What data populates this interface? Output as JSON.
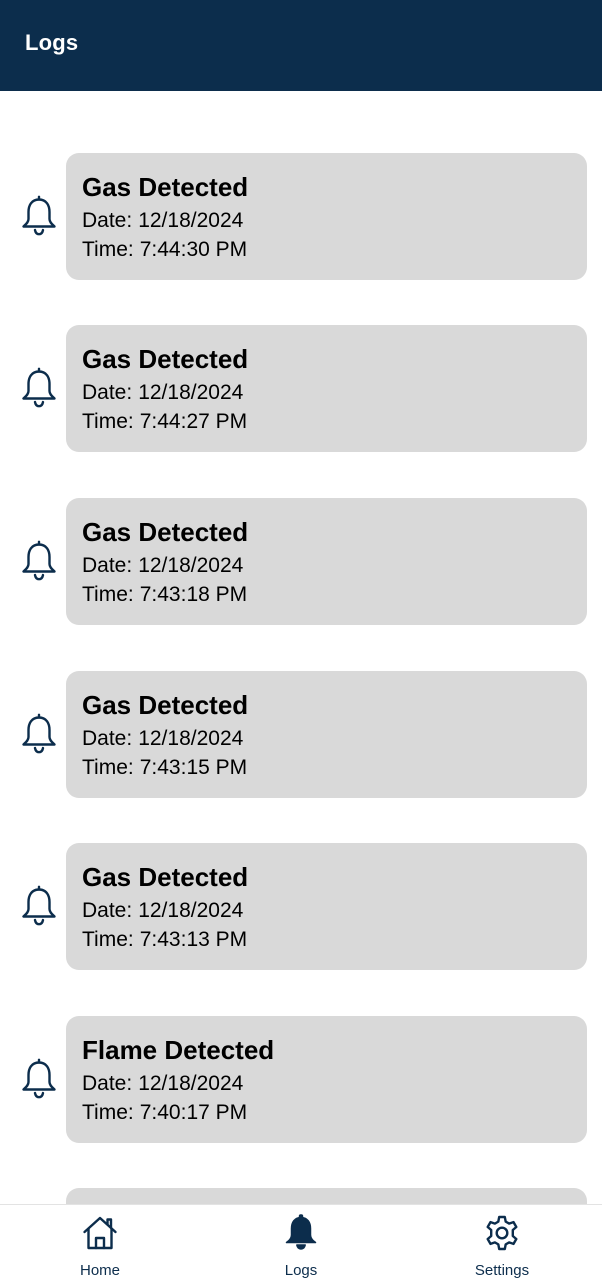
{
  "app_bar": {
    "title": "Logs"
  },
  "logs": [
    {
      "title": "Gas Detected",
      "date_label": "Date:",
      "date": "12/18/2024",
      "time_label": "Time:",
      "time": "7:44:30 PM",
      "icon": "bell-outline-icon"
    },
    {
      "title": "Gas Detected",
      "date_label": "Date:",
      "date": "12/18/2024",
      "time_label": "Time:",
      "time": "7:44:27 PM",
      "icon": "bell-outline-icon"
    },
    {
      "title": "Gas Detected",
      "date_label": "Date:",
      "date": "12/18/2024",
      "time_label": "Time:",
      "time": "7:43:18 PM",
      "icon": "bell-outline-icon"
    },
    {
      "title": "Gas Detected",
      "date_label": "Date:",
      "date": "12/18/2024",
      "time_label": "Time:",
      "time": "7:43:15 PM",
      "icon": "bell-outline-icon"
    },
    {
      "title": "Gas Detected",
      "date_label": "Date:",
      "date": "12/18/2024",
      "time_label": "Time:",
      "time": "7:43:13 PM",
      "icon": "bell-outline-icon"
    },
    {
      "title": "Flame Detected",
      "date_label": "Date:",
      "date": "12/18/2024",
      "time_label": "Time:",
      "time": "7:40:17 PM",
      "icon": "bell-outline-icon"
    }
  ],
  "bottom_nav": {
    "items": [
      {
        "label": "Home",
        "icon": "home-icon",
        "active": false
      },
      {
        "label": "Logs",
        "icon": "bell-filled-icon",
        "active": true
      },
      {
        "label": "Settings",
        "icon": "gear-icon",
        "active": false
      }
    ]
  },
  "colors": {
    "primary": "#0c2d4c",
    "card_background": "#d9d9d9",
    "background": "#ffffff"
  }
}
